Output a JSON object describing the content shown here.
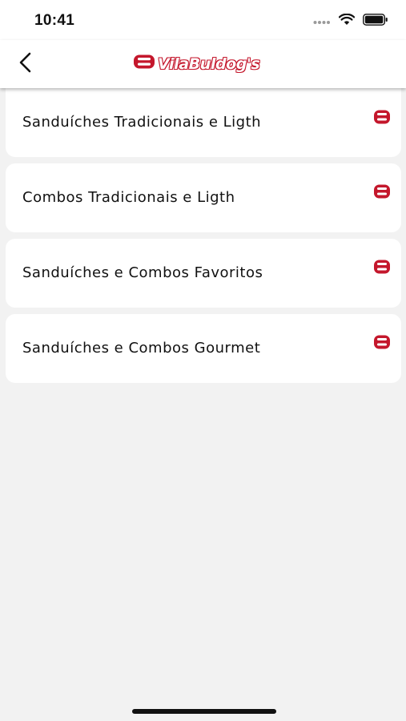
{
  "status_bar": {
    "time": "10:41",
    "icons": [
      "signal-dots-icon",
      "wifi-icon",
      "battery-icon"
    ]
  },
  "header": {
    "back_icon": "chevron-left-icon",
    "logo_text": "VilaBuldog's",
    "brand_color": "#c4172c"
  },
  "categories": [
    {
      "label": "Sanduíches Tradicionais e Ligth",
      "icon": "brand-mark-icon"
    },
    {
      "label": "Combos Tradicionais e Ligth",
      "icon": "brand-mark-icon"
    },
    {
      "label": "Sanduíches e Combos Favoritos",
      "icon": "brand-mark-icon"
    },
    {
      "label": "Sanduíches e Combos Gourmet",
      "icon": "brand-mark-icon"
    }
  ]
}
